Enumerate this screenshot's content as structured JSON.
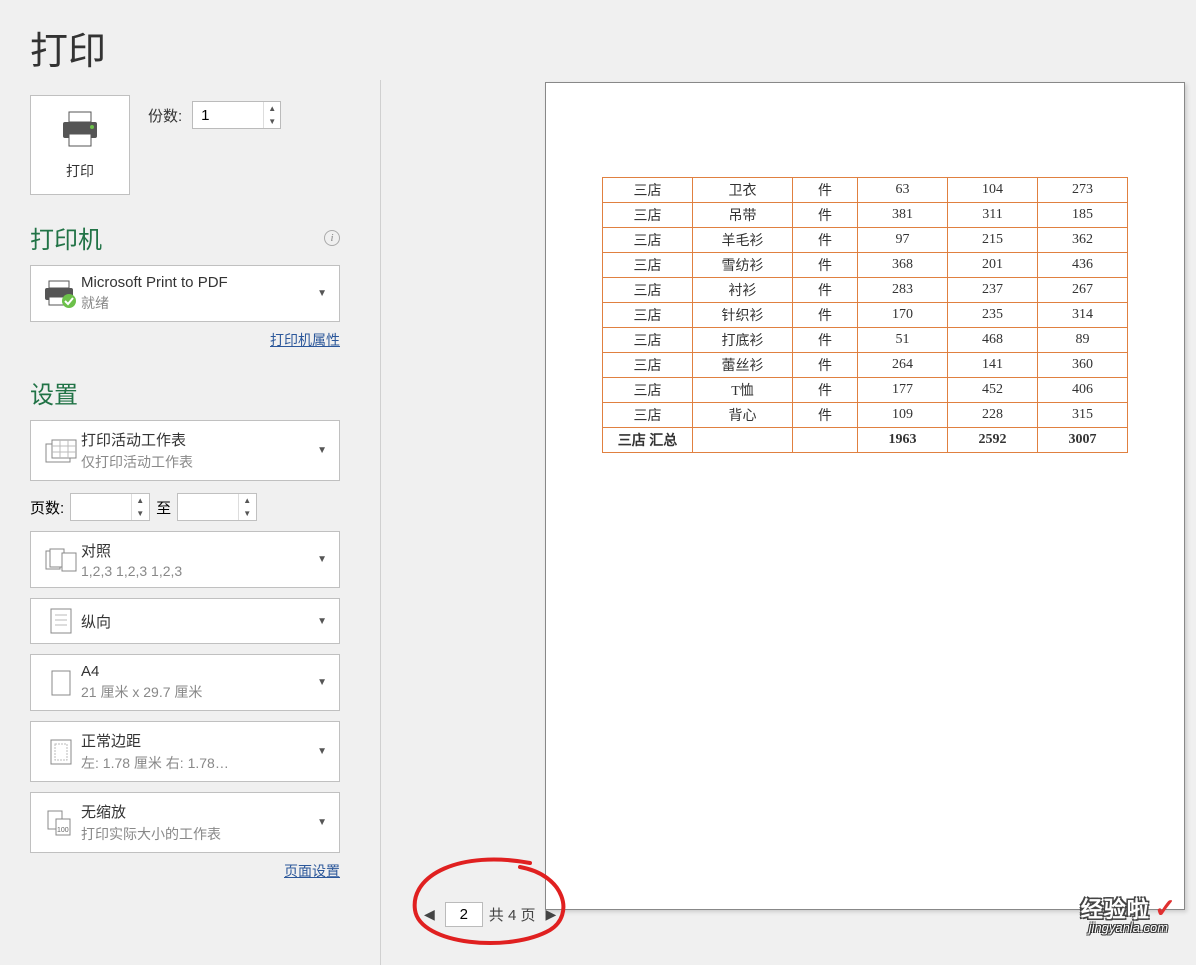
{
  "title": "打印",
  "print_btn_label": "打印",
  "copies_label": "份数:",
  "copies_value": "1",
  "printer_section": "打印机",
  "printer": {
    "name": "Microsoft Print to PDF",
    "status": "就绪"
  },
  "printer_properties_link": "打印机属性",
  "settings_section": "设置",
  "settings": {
    "what": {
      "main": "打印活动工作表",
      "sub": "仅打印活动工作表"
    },
    "pages_label": "页数:",
    "pages_from": "",
    "pages_to_label": "至",
    "pages_to": "",
    "collate": {
      "main": "对照",
      "sub": "1,2,3    1,2,3    1,2,3"
    },
    "orientation": {
      "main": "纵向",
      "sub": ""
    },
    "paper": {
      "main": "A4",
      "sub": "21 厘米 x 29.7 厘米"
    },
    "margins": {
      "main": "正常边距",
      "sub": "左:  1.78 厘米   右:  1.78…"
    },
    "scaling": {
      "main": "无缩放",
      "sub": "打印实际大小的工作表"
    }
  },
  "page_setup_link": "页面设置",
  "pager": {
    "current": "2",
    "total_label": "共 4 页"
  },
  "watermark": {
    "top": "经验啦",
    "check": "✓",
    "bot": "jingyanla.com"
  },
  "chart_data": {
    "type": "table",
    "rows": [
      [
        "三店",
        "卫衣",
        "件",
        "63",
        "104",
        "273"
      ],
      [
        "三店",
        "吊带",
        "件",
        "381",
        "311",
        "185"
      ],
      [
        "三店",
        "羊毛衫",
        "件",
        "97",
        "215",
        "362"
      ],
      [
        "三店",
        "雪纺衫",
        "件",
        "368",
        "201",
        "436"
      ],
      [
        "三店",
        "衬衫",
        "件",
        "283",
        "237",
        "267"
      ],
      [
        "三店",
        "针织衫",
        "件",
        "170",
        "235",
        "314"
      ],
      [
        "三店",
        "打底衫",
        "件",
        "51",
        "468",
        "89"
      ],
      [
        "三店",
        "蕾丝衫",
        "件",
        "264",
        "141",
        "360"
      ],
      [
        "三店",
        "T恤",
        "件",
        "177",
        "452",
        "406"
      ],
      [
        "三店",
        "背心",
        "件",
        "109",
        "228",
        "315"
      ],
      [
        "三店 汇总",
        "",
        "",
        "1963",
        "2592",
        "3007"
      ]
    ]
  }
}
